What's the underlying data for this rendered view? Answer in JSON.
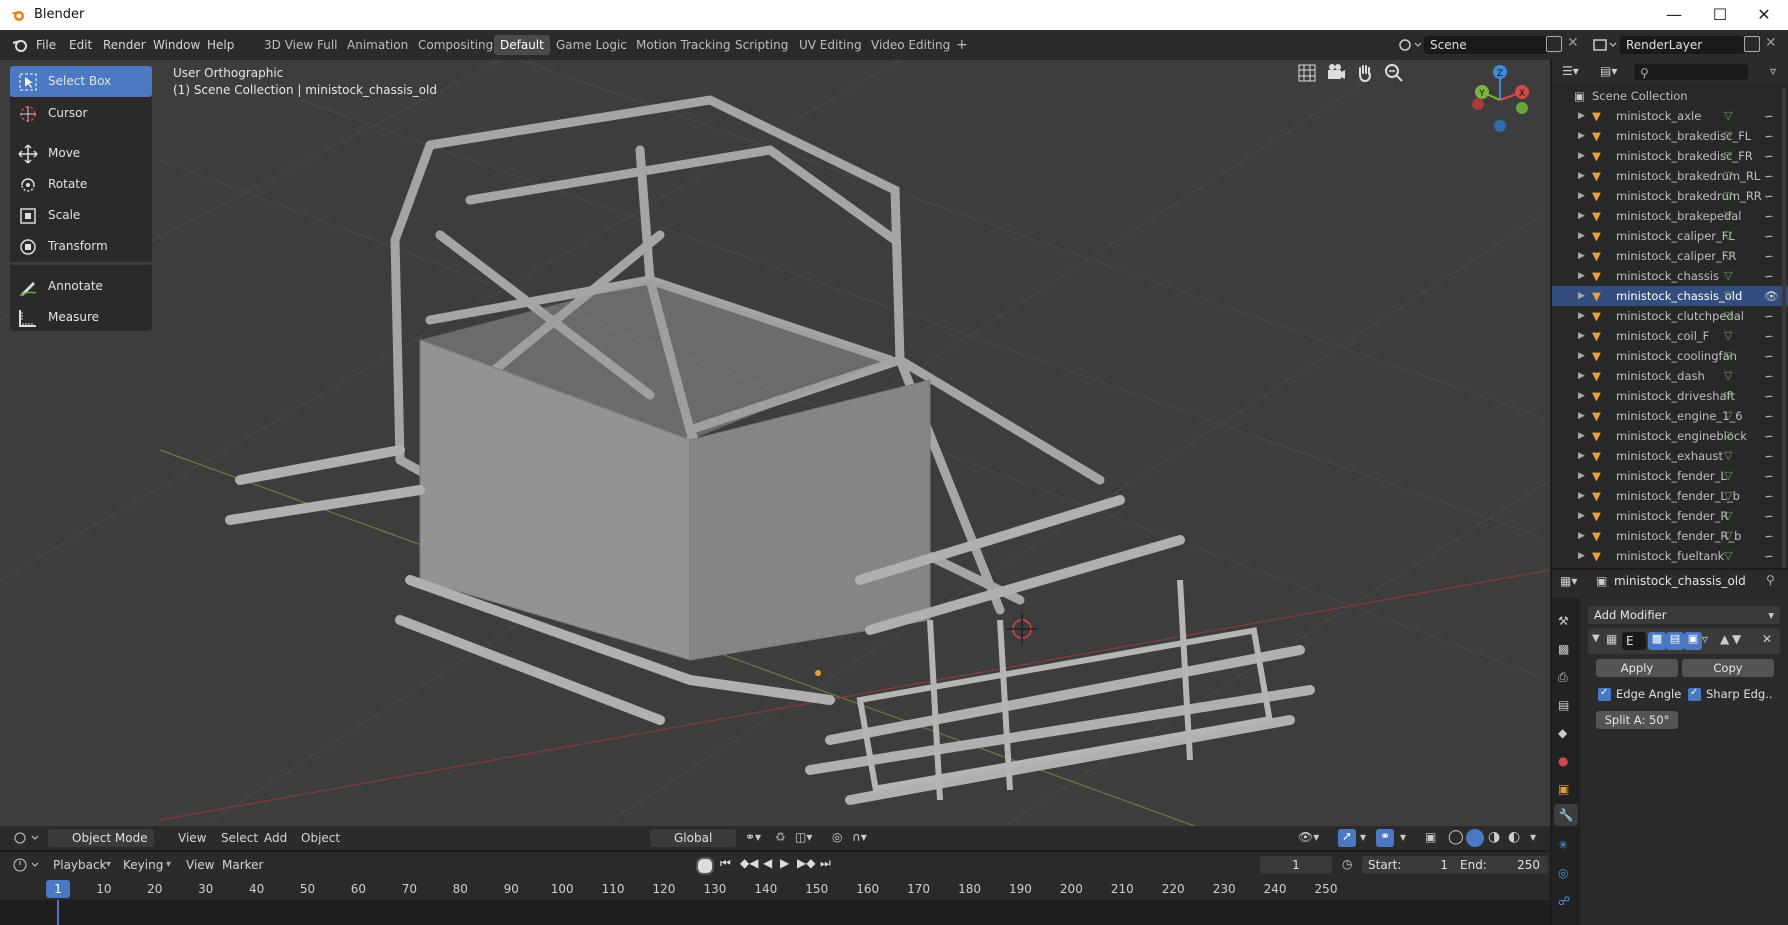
{
  "window": {
    "title": "Blender"
  },
  "menubar": {
    "menus": [
      "File",
      "Edit",
      "Render",
      "Window",
      "Help"
    ],
    "workspaces": [
      "3D View Full",
      "Animation",
      "Compositing",
      "Default",
      "Game Logic",
      "Motion Tracking",
      "Scripting",
      "UV Editing",
      "Video Editing"
    ],
    "active_workspace": "Default",
    "add_workspace": "+",
    "scene": "Scene",
    "render_layer": "RenderLayer"
  },
  "toolbar": {
    "tools": [
      "Select Box",
      "Cursor",
      "Move",
      "Rotate",
      "Scale",
      "Transform",
      "Annotate",
      "Measure"
    ],
    "active": "Select Box"
  },
  "viewport": {
    "view_name": "User Orthographic",
    "collection_info": "(1) Scene Collection | ministock_chassis_old",
    "gizmo_axes": [
      "Z",
      "Y",
      "X"
    ]
  },
  "viewport_header": {
    "mode": "Object Mode",
    "menus": [
      "View",
      "Select",
      "Add",
      "Object"
    ],
    "orientation": "Global"
  },
  "timeline": {
    "menus": [
      "Playback",
      "Keying",
      "View",
      "Marker"
    ],
    "current_frame": "1",
    "start_label": "Start:",
    "start": "1",
    "end_label": "End:",
    "end": "250",
    "ruler": [
      "1",
      "10",
      "20",
      "30",
      "40",
      "50",
      "60",
      "70",
      "80",
      "90",
      "100",
      "110",
      "120",
      "130",
      "140",
      "150",
      "160",
      "170",
      "180",
      "190",
      "200",
      "210",
      "220",
      "230",
      "240",
      "250"
    ]
  },
  "outliner": {
    "root": "Scene Collection",
    "items": [
      "ministock_axle",
      "ministock_brakedisc_FL",
      "ministock_brakedisc_FR",
      "ministock_brakedrum_RL",
      "ministock_brakedrum_RR",
      "ministock_brakepedal",
      "ministock_caliper_FL",
      "ministock_caliper_FR",
      "ministock_chassis",
      "ministock_chassis_old",
      "ministock_clutchpedal",
      "ministock_coil_F",
      "ministock_coolingfan",
      "ministock_dash",
      "ministock_driveshaft",
      "ministock_engine_1_6",
      "ministock_engineblock",
      "ministock_exhaust",
      "ministock_fender_L",
      "ministock_fender_L_b",
      "ministock_fender_R",
      "ministock_fender_R_b",
      "ministock_fueltank"
    ],
    "selected": "ministock_chassis_old"
  },
  "properties": {
    "object_name": "ministock_chassis_old",
    "add_modifier": "Add Modifier",
    "modifier_name": "E",
    "apply": "Apply",
    "copy": "Copy",
    "edge_angle": "Edge Angle",
    "sharp_edges": "Sharp Edg..",
    "split_angle": "Split A: 50°"
  },
  "colors": {
    "accent": "#4a78c3",
    "selected_row": "#334d80",
    "viewport": "#3d3d3d",
    "axis_x": "#d64848",
    "axis_y": "#7cb53c",
    "axis_z": "#3e8ad9"
  }
}
